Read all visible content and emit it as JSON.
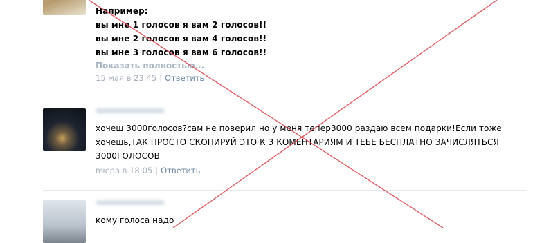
{
  "comments": [
    {
      "lines": [
        "Например:",
        "вы мне 1 голосов я вам 2 голосов!!",
        "вы мне 2 голосов я вам 4 голосов!!",
        "вы мне 3 голосов я вам 6 голосов!!"
      ],
      "expand_label": "Показать полностью...",
      "date": "15 мая в 23:45",
      "reply_label": "Ответить"
    },
    {
      "lines": [
        "хочеш 3000голосов?сам не поверил но у меня тепер3000 раздаю всем подарки!Если тоже",
        "хочешь,ТАК ПРОСТО СКОПИРУЙ ЭТО К 3 КОМЕНТАРИЯМ И ТЕБЕ БЕСПЛАТНО ЗАЧИСЛЯТЬСЯ",
        "3000ГОЛОСОВ"
      ],
      "date": "вчера в 18:05",
      "reply_label": "Ответить"
    },
    {
      "lines": [
        "кому голоса надо"
      ]
    }
  ],
  "colors": {
    "cross": "#d9434a",
    "link": "#6d87a6",
    "meta": "#a9b2bd"
  }
}
